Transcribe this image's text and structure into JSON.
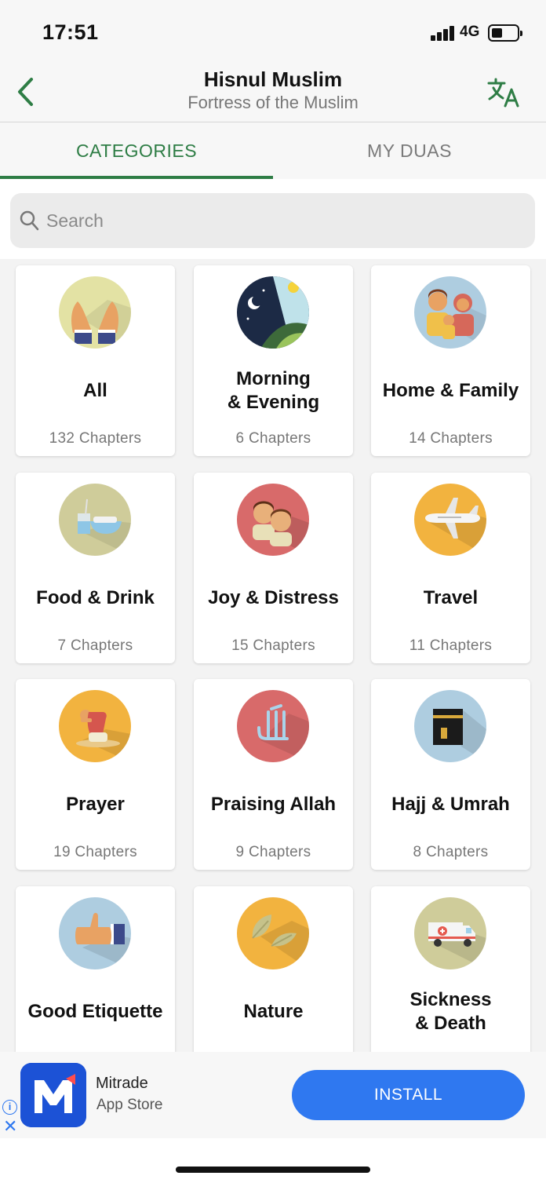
{
  "status_bar": {
    "time": "17:51",
    "network": "4G"
  },
  "header": {
    "title": "Hisnul Muslim",
    "subtitle": "Fortress of the Muslim"
  },
  "tabs": [
    {
      "label": "CATEGORIES",
      "active": true
    },
    {
      "label": "MY DUAS",
      "active": false
    }
  ],
  "search": {
    "placeholder": "Search",
    "value": ""
  },
  "categories": [
    {
      "name": "All",
      "count": "132 Chapters",
      "icon": "raised-hands-icon",
      "color": "#e3e2a4"
    },
    {
      "name": "Morning\n& Evening",
      "count": "6 Chapters",
      "icon": "day-night-icon",
      "color": "#1c2a45"
    },
    {
      "name": "Home & Family",
      "count": "14 Chapters",
      "icon": "family-icon",
      "color": "#aecde0"
    },
    {
      "name": "Food & Drink",
      "count": "7 Chapters",
      "icon": "food-drink-icon",
      "color": "#cfcc9a"
    },
    {
      "name": "Joy & Distress",
      "count": "15 Chapters",
      "icon": "two-faces-icon",
      "color": "#d86a6a"
    },
    {
      "name": "Travel",
      "count": "11 Chapters",
      "icon": "airplane-icon",
      "color": "#f2b33f"
    },
    {
      "name": "Prayer",
      "count": "19 Chapters",
      "icon": "praying-person-icon",
      "color": "#f2b33f"
    },
    {
      "name": "Praising Allah",
      "count": "9 Chapters",
      "icon": "allah-calligraphy-icon",
      "color": "#d86a6a"
    },
    {
      "name": "Hajj & Umrah",
      "count": "8 Chapters",
      "icon": "kaaba-icon",
      "color": "#aecde0"
    },
    {
      "name": "Good Etiquette",
      "count": "",
      "icon": "thumbs-up-icon",
      "color": "#aecde0"
    },
    {
      "name": "Nature",
      "count": "",
      "icon": "leaves-icon",
      "color": "#f2b33f"
    },
    {
      "name": "Sickness\n& Death",
      "count": "",
      "icon": "ambulance-icon",
      "color": "#cfcc9a"
    }
  ],
  "ad": {
    "app_name": "Mitrade",
    "store": "App Store",
    "install_label": "INSTALL",
    "info": "i",
    "close": "✕"
  },
  "colors": {
    "accent": "#2e7d45",
    "install": "#2f78f0"
  }
}
